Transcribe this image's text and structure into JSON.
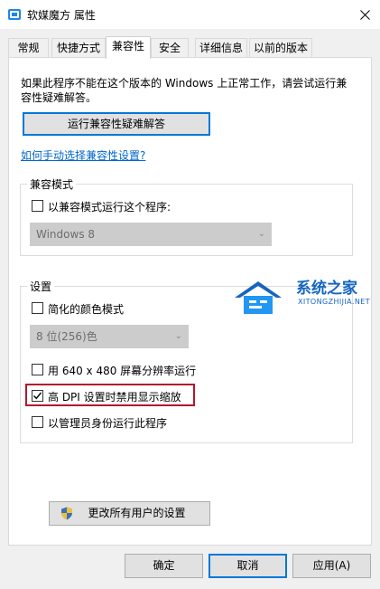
{
  "window": {
    "title": "软媒魔方 属性",
    "close_icon": "close-icon",
    "app_icon": "app-icon"
  },
  "tabs": [
    {
      "label": "常规"
    },
    {
      "label": "快捷方式"
    },
    {
      "label": "兼容性",
      "active": true
    },
    {
      "label": "安全"
    },
    {
      "label": "详细信息"
    },
    {
      "label": "以前的版本"
    }
  ],
  "compat": {
    "intro_line1": "如果此程序不能在这个版本的 Windows 上正常工作，请尝试运行兼",
    "intro_line2": "容性疑难解答。",
    "troubleshooter_button": "运行兼容性疑难解答",
    "manual_link": "如何手动选择兼容性设置?",
    "mode_group": {
      "label": "兼容模式",
      "checkbox_label": "以兼容模式运行这个程序:",
      "checked": false,
      "os_select": "Windows 8"
    },
    "settings_group": {
      "label": "设置",
      "reduced_color": {
        "label": "简化的颜色模式",
        "checked": false
      },
      "color_select": "8 位(256)色",
      "res_640": {
        "label": "用 640 x 480 屏幕分辨率运行",
        "checked": false
      },
      "dpi": {
        "label": "高 DPI 设置时禁用显示缩放",
        "checked": true
      },
      "admin": {
        "label": "以管理员身份运行此程序",
        "checked": false
      }
    },
    "all_users_button": "更改所有用户的设置"
  },
  "footer": {
    "ok": "确定",
    "cancel": "取消",
    "apply": "应用(A)"
  },
  "watermark": {
    "text": "系统之家",
    "subtext": "XITONGZHIJIA.NET"
  },
  "colors": {
    "accent": "#0078d7",
    "highlight_box": "#b3172d",
    "link": "#0066cc",
    "watermark": "#1565c0"
  }
}
